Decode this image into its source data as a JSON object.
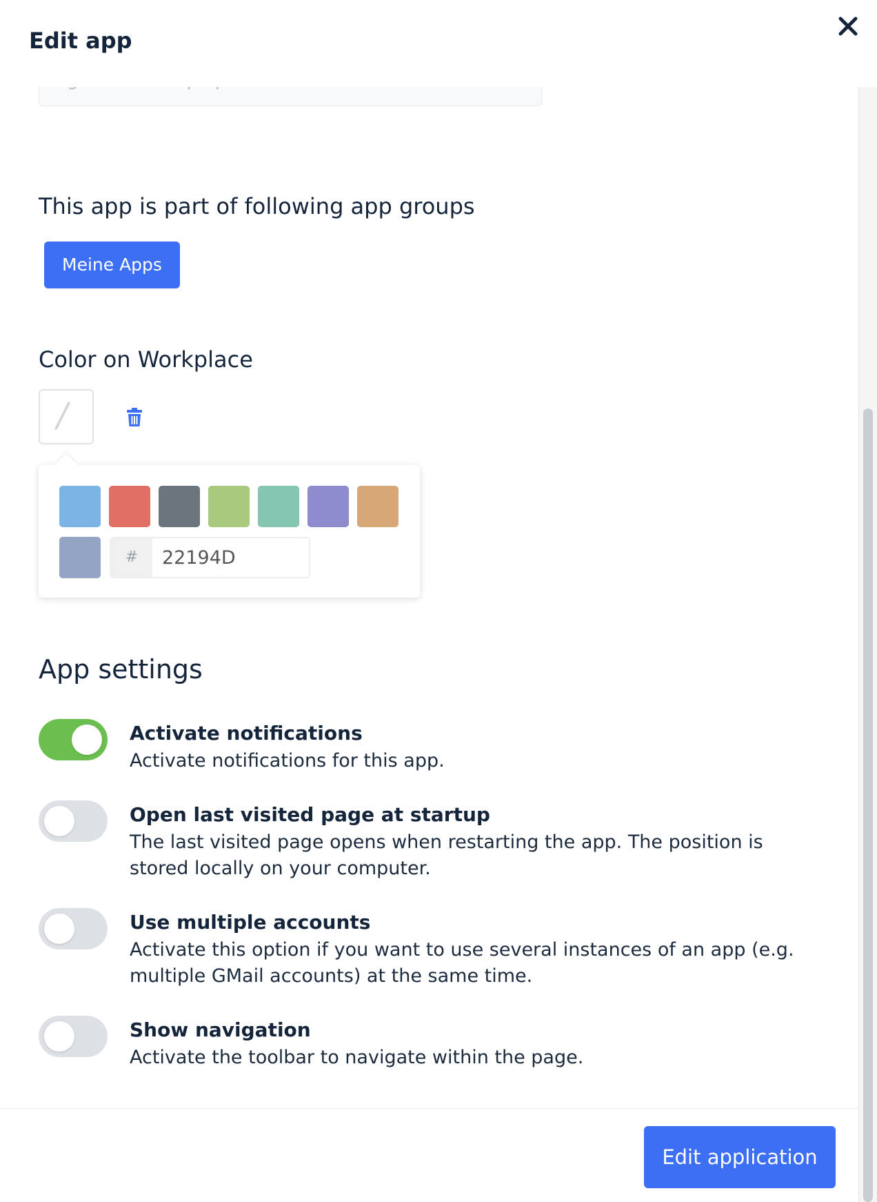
{
  "header": {
    "title": "Edit app"
  },
  "groups": {
    "heading": "This app is part of following app groups",
    "chips": [
      "Meine Apps"
    ]
  },
  "color": {
    "heading": "Color on Workplace",
    "preview_glyph": "/",
    "swatches": [
      "#7ab4e5",
      "#e07065",
      "#6c757d",
      "#a9c97c",
      "#85c6b3",
      "#8e8ccc",
      "#d6a878",
      "#93a4c5"
    ],
    "hex_prefix": "#",
    "hex_value": "22194D"
  },
  "settings": {
    "heading": "App settings",
    "items": [
      {
        "title": "Activate notifications",
        "desc": "Activate notifications for this app.",
        "on": true
      },
      {
        "title": "Open last visited page at startup",
        "desc": "The last visited page opens when restarting the app. The position is stored locally on your computer.",
        "on": false
      },
      {
        "title": "Use multiple accounts",
        "desc": "Activate this option if you want to use several instances of an app (e.g. multiple GMail accounts) at the same time.",
        "on": false
      },
      {
        "title": "Show navigation",
        "desc": "Activate the toolbar to navigate within the page.",
        "on": false
      }
    ]
  },
  "footer": {
    "submit_label": "Edit application"
  },
  "colors": {
    "primary": "#3d6ff5",
    "toggle_on": "#6bbf4f",
    "toggle_off": "#dde1e6"
  }
}
